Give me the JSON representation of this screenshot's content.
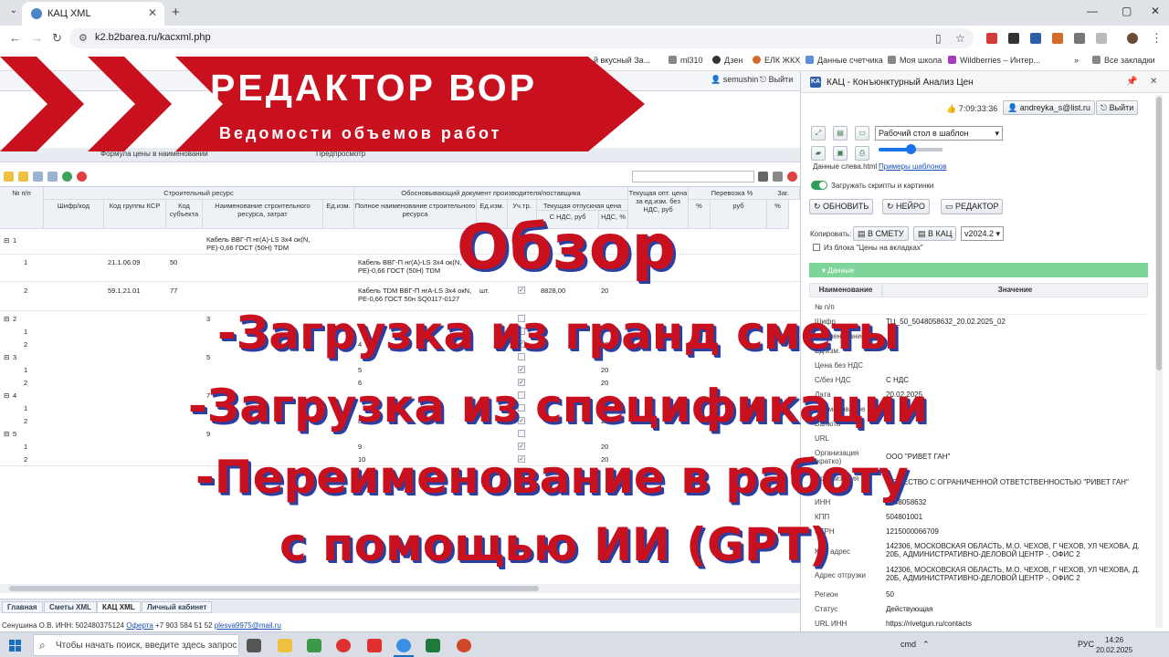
{
  "browser": {
    "tab_title": "КАЦ XML",
    "url": "k2.b2barea.ru/kacxml.php",
    "bookmarks": [
      "й вкусный За...",
      "ml310",
      "Дзен",
      "ЕЛК ЖКХ",
      "Данные счетчика",
      "Моя школа",
      "Wildberries – Интер...",
      "Все закладки"
    ]
  },
  "app": {
    "user": "semushin",
    "logout": "Выйти",
    "subnav": [
      "Формула цены в наименовании",
      "Предпросмотр"
    ],
    "grid": {
      "headers": {
        "num": "№ п/п",
        "group_res": "Строительный ресурс",
        "code": "Шифр/код",
        "ksr": "Код группы КСР",
        "subject": "Код субъекта",
        "name": "Наименование строительного ресурса, затрат",
        "unit": "Ед.изм.",
        "group_doc": "Обосновывающий документ производителя/поставщика",
        "full_name": "Полное наименование строительного ресурса",
        "unit2": "Ед.изм.",
        "uch": "Уч.тр.",
        "price_group": "Текущая отпускная цена",
        "price_ndc": "С НДС, руб",
        "ndc": "НДС, %",
        "opt": "Текущая опт. цена за ед.изм. без НДС, руб",
        "transport": "Перевозка %",
        "pct": "%",
        "rub": "руб",
        "zag": "Заг.",
        "pct2": "%"
      },
      "rows": [
        {
          "num": "1",
          "name": "Кабель ВВГ-П нг(А)-LS 3х4 ок(N, PE)-0,66 ГОСТ (50Н) TDM",
          "group": true
        },
        {
          "num": "1",
          "ksr": "21.1.06.09",
          "subject": "50",
          "full": "Кабель ВВГ-П нг(А)-LS 3х4 ок(N, PE)-0,66 ГОСТ (50Н) TDM",
          "unit": "шт.",
          "price": "",
          "ndc": "20"
        },
        {
          "num": "2",
          "ksr": "59.1.21.01",
          "subject": "77",
          "full": "Кабель TDM ВВГ-П нгА-LS 3х4 окN, PE-0,66 ГОСТ 50н SQ0117-0127",
          "unit": "шт.",
          "price": "8828,00",
          "ndc": "20"
        },
        {
          "num": "2",
          "name": "3",
          "group": true
        },
        {
          "num": "1",
          "full": "",
          "ndc": ""
        },
        {
          "num": "2",
          "full": "4",
          "ndc": "20"
        },
        {
          "num": "3",
          "name": "5",
          "group": true
        },
        {
          "num": "1",
          "full": "5",
          "ndc": "20"
        },
        {
          "num": "2",
          "full": "6",
          "ndc": "20"
        },
        {
          "num": "4",
          "name": "7",
          "group": true
        },
        {
          "num": "1",
          "full": "",
          "ndc": ""
        },
        {
          "num": "2",
          "full": "8",
          "ndc": "20"
        },
        {
          "num": "5",
          "name": "9",
          "group": true
        },
        {
          "num": "1",
          "full": "9",
          "ndc": "20"
        },
        {
          "num": "2",
          "full": "10",
          "ndc": "20"
        }
      ]
    },
    "bottom_tabs": [
      "Главная",
      "Сметы XML",
      "КАЦ XML",
      "Личный кабинет"
    ],
    "footer": {
      "user": "Сенушина О.В. ИНН: 502480375124",
      "oferta": "Оферта",
      "phone": "+7 903 584 51 52",
      "email": "plesva9975@mail.ru"
    }
  },
  "panel": {
    "title": "КАЦ - Конъюнктурный Анализ Цен",
    "time": "7:09:33:36",
    "email_btn": "andreyka_s@list.ru",
    "logout": "Выйти",
    "select_desk": "Рабочий стол в шаблон",
    "data_left": "Данные слева.html",
    "examples": "Примеры шаблонов",
    "load_scripts": "Загружать скрипты и картинки",
    "btn_refresh": "ОБНОВИТЬ",
    "btn_neuro": "НЕЙРО",
    "btn_editor": "РЕДАКТОР",
    "copy_label": "Копировать:",
    "btn_to_smeta": "В СМЕТУ",
    "btn_to_kac": "В КАЦ",
    "version": "v2024.2",
    "from_block": "Из блока \"Цены на вкладках\"",
    "data_section": "Данные",
    "col_name": "Наименование",
    "col_value": "Значение",
    "fields": [
      {
        "label": "№ п/п",
        "value": ""
      },
      {
        "label": "Шифр",
        "value": "ТЦ_50_5048058632_20.02.2025_02"
      },
      {
        "label": "Наименование",
        "value": ""
      },
      {
        "label": "Ед.изм.",
        "value": ""
      },
      {
        "label": "Цена без НДС",
        "value": ""
      },
      {
        "label": "С/без НДС",
        "value": "С НДС"
      },
      {
        "label": "Дата",
        "value": "20.02.2025"
      },
      {
        "label": "Наименование",
        "value": ""
      },
      {
        "label": "Валюта",
        "value": ""
      },
      {
        "label": "URL",
        "value": ""
      },
      {
        "label": "Организация (кратко)",
        "value": "ООО \"РИВЕТ ГАН\""
      },
      {
        "label": "Организация",
        "value": "ОБЩЕСТВО С ОГРАНИЧЕННОЙ ОТВЕТСТВЕННОСТЬЮ \"РИВЕТ ГАН\""
      },
      {
        "label": "ИНН",
        "value": "5048058632"
      },
      {
        "label": "КПП",
        "value": "504801001"
      },
      {
        "label": "ОГРН",
        "value": "1215000066709"
      },
      {
        "label": "Юр. адрес",
        "value": "142306, МОСКОВСКАЯ ОБЛАСТЬ, М.О. ЧЕХОВ, Г ЧЕХОВ, УЛ ЧЕХОВА, Д. 20Б, АДМИНИСТРАТИВНО-ДЕЛОВОЙ ЦЕНТР -, ОФИС 2"
      },
      {
        "label": "Адрес отгрузки",
        "value": "142306, МОСКОВСКАЯ ОБЛАСТЬ, М.О. ЧЕХОВ, Г ЧЕХОВ, УЛ ЧЕХОВА, Д. 20Б, АДМИНИСТРАТИВНО-ДЕЛОВОЙ ЦЕНТР -, ОФИС 2"
      },
      {
        "label": "Регион",
        "value": "50"
      },
      {
        "label": "Статус",
        "value": "Действующая"
      },
      {
        "label": "URL ИНН",
        "value": "https://rivetgun.ru/contacts"
      }
    ]
  },
  "banner": {
    "title": "РЕДАКТОР ВОР",
    "subtitle": "Ведомости объемов работ"
  },
  "overlay": {
    "heading": "Обзор",
    "line1": "-Загрузка из гранд сметы",
    "line2": "-Загрузка из спецификации",
    "line3": "-Переименование в работу",
    "line4": "с помощью ИИ (GPT)"
  },
  "taskbar": {
    "search_placeholder": "Чтобы начать поиск, введите здесь запрос",
    "tray_cmd": "cmd",
    "lang": "РУС",
    "time": "14:26",
    "date": "20.02.2025"
  },
  "colors": {
    "banner_red": "#c8101e",
    "overlay_red": "#c8101e",
    "overlay_shadow": "#2a3fa0",
    "accent_green": "#7fd49a"
  }
}
